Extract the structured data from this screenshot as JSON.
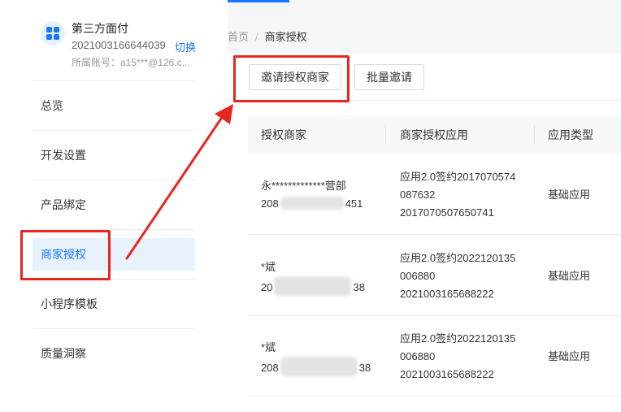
{
  "account": {
    "name": "第三方面付",
    "id": "2021003166644039",
    "switch_label": "切换",
    "owner": "所属账号：a15***@126.c..."
  },
  "sidebar": {
    "items": [
      {
        "label": "总览"
      },
      {
        "label": "开发设置"
      },
      {
        "label": "产品绑定"
      },
      {
        "label": "商家授权"
      },
      {
        "label": "小程序模板"
      },
      {
        "label": "质量洞察"
      }
    ]
  },
  "breadcrumb": {
    "home": "首页",
    "separator": "/",
    "current": "商家授权"
  },
  "toolbar": {
    "invite_label": "邀请授权商家",
    "batch_label": "批量邀请"
  },
  "table": {
    "headers": [
      "授权商家",
      "商家授权应用",
      "应用类型"
    ],
    "rows": [
      {
        "merchant_name": "永*************营部",
        "merchant_id_prefix": "208",
        "merchant_id_suffix": "451",
        "app_line1": "应用2.0签约2017070574",
        "app_line2": "087632",
        "app_line3": "2017070507650741",
        "app_type": "基础应用"
      },
      {
        "merchant_name": "*斌",
        "merchant_id_prefix": "20",
        "merchant_id_suffix": "38",
        "app_line1": "应用2.0签约2022120135",
        "app_line2": "006880",
        "app_line3": "2021003165688222",
        "app_type": "基础应用"
      },
      {
        "merchant_name": "*斌",
        "merchant_id_prefix": "208",
        "merchant_id_suffix": "38",
        "app_line1": "应用2.0签约2022120135",
        "app_line2": "006880",
        "app_line3": "2021003165688222",
        "app_type": "基础应用"
      }
    ]
  },
  "colors": {
    "accent": "#1677ff",
    "active_bg": "#e8f2fd",
    "annotation": "#e8261f"
  }
}
